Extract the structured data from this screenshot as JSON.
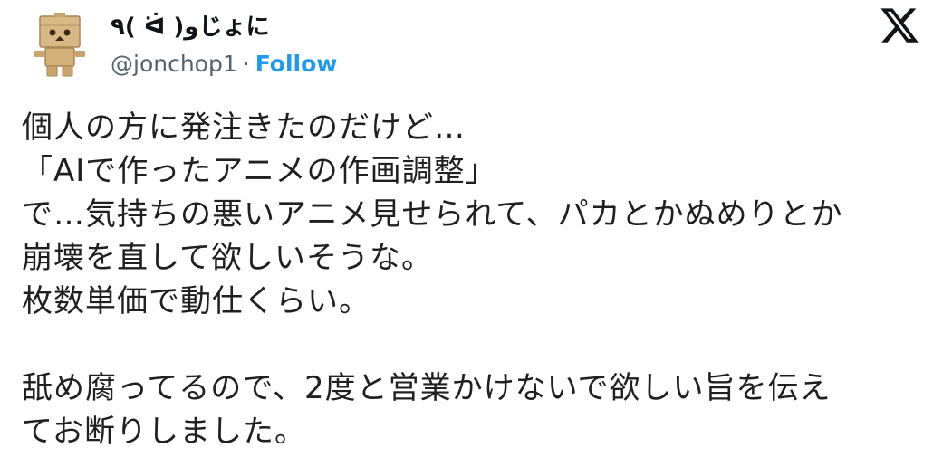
{
  "author": {
    "display_name": "٩( ᐛ )وじょに",
    "handle": "@jonchop1",
    "separator": "·",
    "follow_label": "Follow"
  },
  "brand": {
    "logo_icon": "x-logo-icon",
    "text_color": "#0f1419",
    "secondary_color": "#536471",
    "accent_color": "#1d9bf0"
  },
  "tweet": {
    "lines": [
      "個人の方に発注きたのだけど…",
      "「AIで作ったアニメの作画調整」",
      "で…気持ちの悪いアニメ見せられて、パカとかぬめりとか",
      "崩壊を直して欲しいそうな。",
      "枚数単価で動仕くらい。",
      "",
      "舐め腐ってるので、2度と営業かけないで欲しい旨を伝え",
      "てお断りしました。"
    ]
  }
}
